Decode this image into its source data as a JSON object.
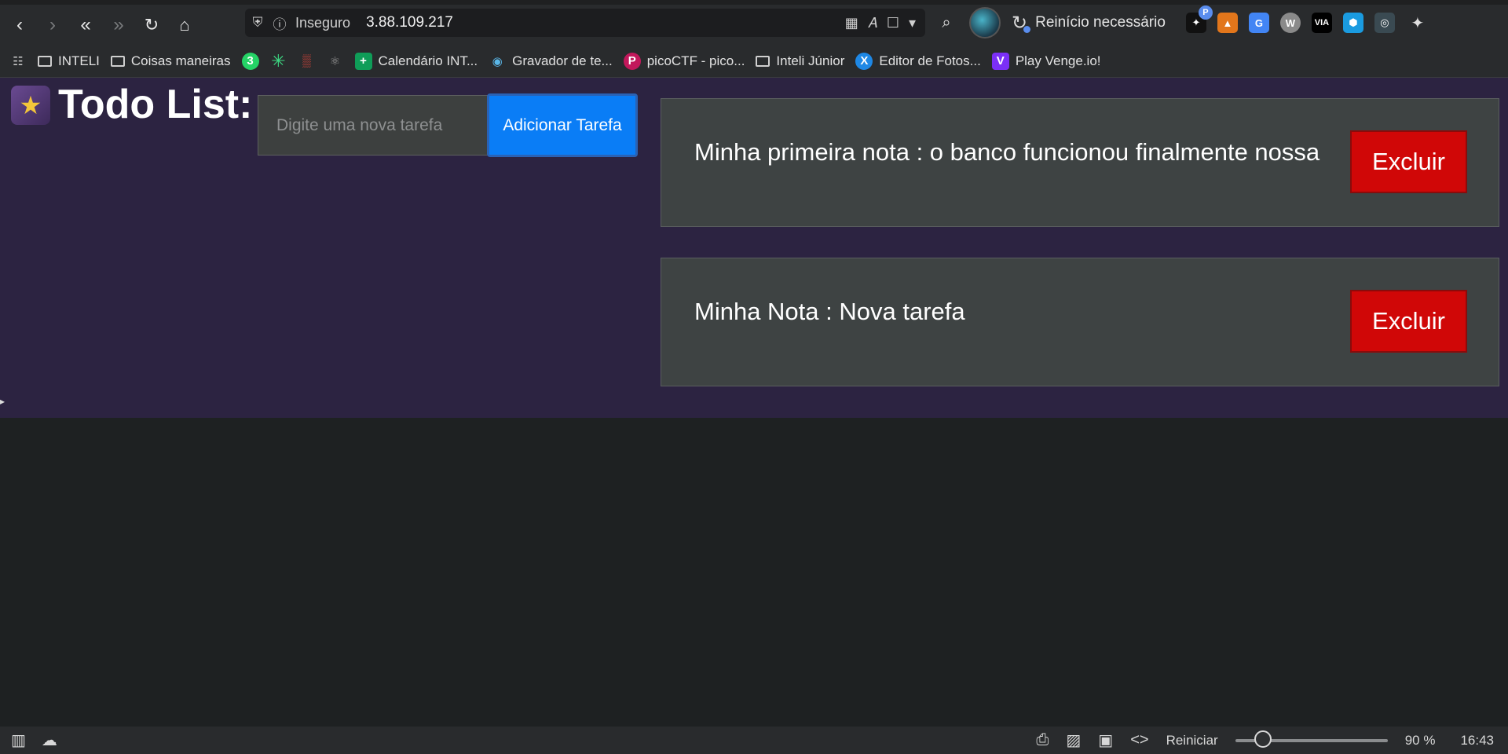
{
  "browser": {
    "security_label": "Inseguro",
    "url": "3.88.109.217",
    "restart_label": "Reinício necessário",
    "extension_badge": "P",
    "via_label": "VIA"
  },
  "bookmarks": [
    {
      "label": "INTELI",
      "icon": "folder-icon"
    },
    {
      "label": "Coisas maneiras",
      "icon": "folder-icon"
    },
    {
      "label": "",
      "icon": "whatsapp-icon",
      "badge": "3"
    },
    {
      "label": "",
      "icon": "asterisk-icon"
    },
    {
      "label": "",
      "icon": "red-grid-icon"
    },
    {
      "label": "",
      "icon": "atom-icon"
    },
    {
      "label": "Calendário INT...",
      "icon": "calendar-icon"
    },
    {
      "label": "Gravador de te...",
      "icon": "recorder-icon"
    },
    {
      "label": "picoCTF - pico...",
      "icon": "picoctf-icon"
    },
    {
      "label": "Inteli Júnior",
      "icon": "folder-icon"
    },
    {
      "label": "Editor de Fotos...",
      "icon": "photo-editor-icon"
    },
    {
      "label": "Play Venge.io!",
      "icon": "venge-icon"
    }
  ],
  "app": {
    "title": "Todo List:",
    "input_placeholder": "Digite uma nova tarefa",
    "add_button": "Adicionar Tarefa",
    "notes": [
      {
        "text": "Minha primeira nota : o banco funcionou finalmente nossa",
        "delete_label": "Excluir"
      },
      {
        "text": "Minha Nota : Nova tarefa",
        "delete_label": "Excluir"
      }
    ]
  },
  "statusbar": {
    "reset_label": "Reiniciar",
    "zoom_level": "90 %",
    "zoom_fraction": 0.18,
    "clock": "16:43"
  }
}
